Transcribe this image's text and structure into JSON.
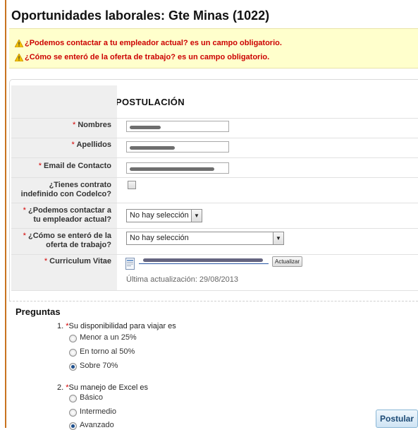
{
  "page": {
    "title": "Oportunidades laborales: Gte Minas (1022)"
  },
  "errors": [
    "¿Podemos contactar a tu empleador actual? es un campo obligatorio.",
    "¿Cómo se enteró de la oferta de trabajo? es un campo obligatorio."
  ],
  "form": {
    "section_title": "POSTULACIÓN",
    "required_marker": "*",
    "fields": {
      "nombres": {
        "label": "Nombres"
      },
      "apellidos": {
        "label": "Apellidos"
      },
      "email": {
        "label": "Email de Contacto"
      },
      "contrato": {
        "label_line1": "¿Tienes contrato",
        "label_line2": "indefinido con Codelco?"
      },
      "empleador": {
        "label_line1": "¿Podemos contactar a",
        "label_line2": "tu empleador actual?",
        "selected": "No hay selección"
      },
      "oferta": {
        "label_line1": "¿Cómo se enteró de la",
        "label_line2": "oferta de trabajo?",
        "selected": "No hay selección"
      },
      "cv": {
        "label": "Curriculum Vitae",
        "update_button": "Actualizar",
        "last_update": "Última actualización: 29/08/2013"
      }
    }
  },
  "questions": {
    "title": "Preguntas",
    "items": [
      {
        "number": "1.",
        "text": "Su disponibilidad para viajar es",
        "options": [
          "Menor a un 25%",
          "En torno al 50%",
          "Sobre 70%"
        ],
        "selected_index": 2
      },
      {
        "number": "2.",
        "text": "Su manejo de Excel es",
        "options": [
          "Básico",
          "Intermedio",
          "Avanzado"
        ],
        "selected_index": 2
      }
    ]
  },
  "actions": {
    "submit": "Postular"
  },
  "colors": {
    "error": "#cc0000",
    "required": "#d40000",
    "accent_arrow": "#e0312b",
    "left_rule": "#c8731f"
  }
}
